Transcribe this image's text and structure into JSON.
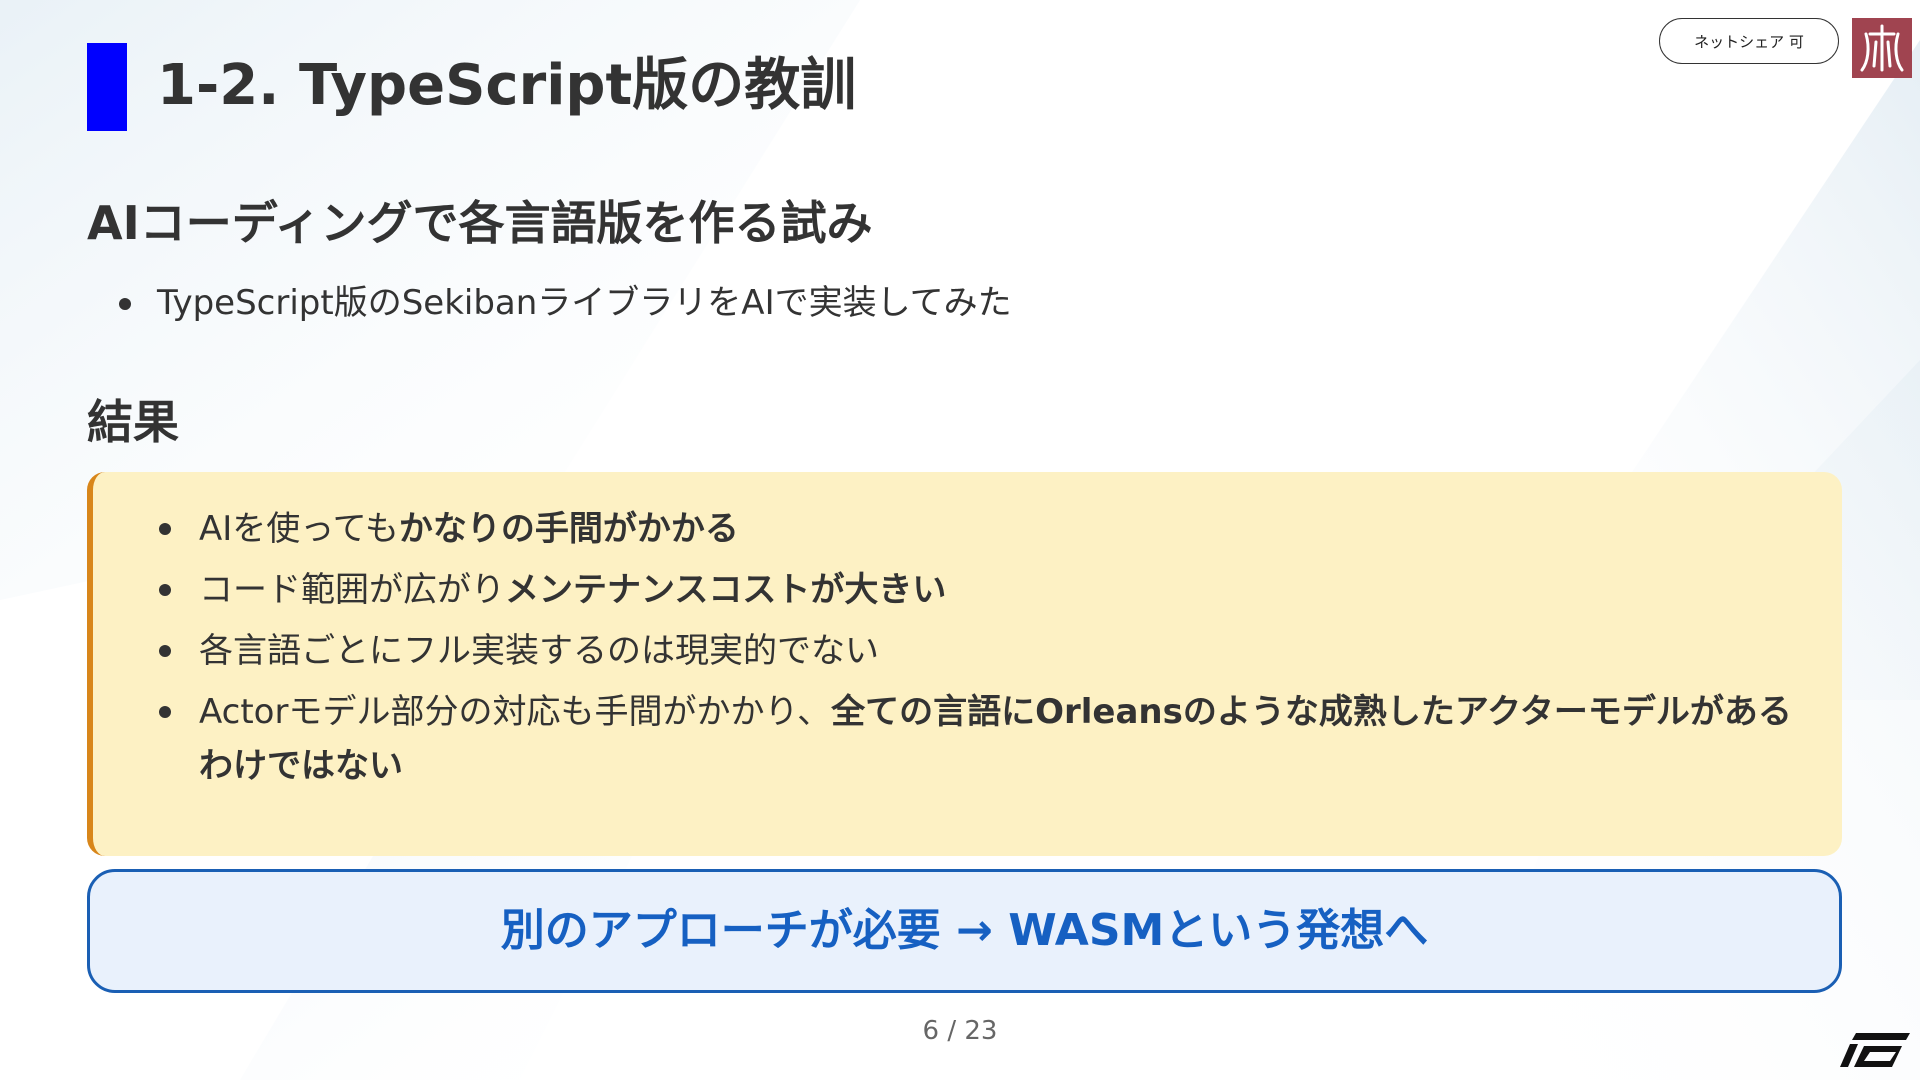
{
  "slide": {
    "title": "1-2. TypeScript版の教訓",
    "share_badge": "ネットシェア 可",
    "section_attempt": {
      "heading": "AIコーディングで各言語版を作る試み",
      "bullets": [
        "TypeScript版のSekibanライブラリをAIで実装してみた"
      ]
    },
    "section_result": {
      "heading": "結果",
      "bullets": [
        {
          "plain": "AIを使っても",
          "strong": "かなりの手間がかかる"
        },
        {
          "plain": "コード範囲が広がり",
          "strong": "メンテナンスコストが大きい"
        },
        {
          "plain": "各言語ごとにフル実装するのは現実的でない",
          "strong": ""
        },
        {
          "plain": "Actorモデル部分の対応も手間がかかり、",
          "strong": "全ての言語にOrleansのような成熟したアクターモデルがあるわけではない"
        }
      ]
    },
    "conclusion": "別のアプローチが必要 → WASMという発想へ",
    "page_number": "6 / 23"
  },
  "colors": {
    "title_accent": "#0000ff",
    "result_box_bg": "#fdf1c4",
    "result_box_border": "#d8861a",
    "conclusion_bg": "#e9f1fc",
    "conclusion_border": "#1a5fb4",
    "conclusion_text": "#1660c2",
    "logo_seal": "#a04450"
  },
  "icons": {
    "logo_seal": "kanji-seal-logo-icon",
    "corner_logo": "slanted-stripes-logo-icon",
    "bullet": "bullet-dot-icon"
  }
}
